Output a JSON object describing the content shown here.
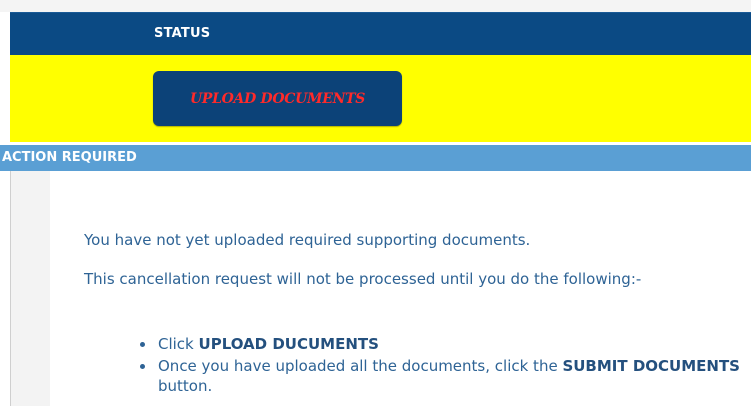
{
  "status": {
    "header_label": "STATUS",
    "upload_button_label": "UPLOAD DOCUMENTS"
  },
  "action": {
    "header_label": "ACTION REQUIRED",
    "message_1": "You have not yet uploaded required supporting documents.",
    "message_2": "This cancellation request will not be processed until you do the following:-",
    "steps": [
      {
        "prefix": "Click ",
        "emphasis": "UPLOAD DUCUMENTS",
        "suffix": ""
      },
      {
        "prefix": "Once you have uploaded all the documents, click the ",
        "emphasis": "SUBMIT DOCUMENTS",
        "suffix": " button."
      }
    ]
  },
  "colors": {
    "status_bar": "#0b4a84",
    "status_row": "#ffff00",
    "upload_button_bg": "#0c4278",
    "upload_button_text": "#ff2a2a",
    "action_bar": "#5a9fd4",
    "body_text": "#2e6395"
  }
}
